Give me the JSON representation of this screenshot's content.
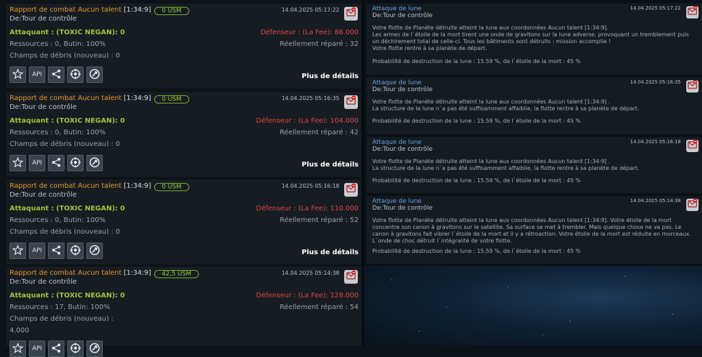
{
  "combat_reports": [
    {
      "title": "Rapport de combat Aucun talent",
      "coords": "[1:34:9]",
      "usm": "0 USM",
      "from": "De:Tour de contrôle",
      "date": "14.04.2025 05:17:22",
      "attacker": "Attaquant : (TOXIC NEGAN): 0",
      "defender": "Défenseur : (La Fee): 86.000",
      "resources": "Ressources : 0, Butin: 100%",
      "repaired": "Réellement réparé : 32",
      "debris": "Champs de débris (nouveau) : 0",
      "debris_value": "",
      "more": "Plus de détails"
    },
    {
      "title": "Rapport de combat Aucun talent",
      "coords": "[1:34:9]",
      "usm": "0 USM",
      "from": "De:Tour de contrôle",
      "date": "14.04.2025 05:16:35",
      "attacker": "Attaquant : (TOXIC NEGAN): 0",
      "defender": "Défenseur : (La Fee): 104.000",
      "resources": "Ressources : 0, Butin: 100%",
      "repaired": "Réellement réparé : 42",
      "debris": "Champs de débris (nouveau) : 0",
      "debris_value": "",
      "more": "Plus de détails"
    },
    {
      "title": "Rapport de combat Aucun talent",
      "coords": "[1:34:9]",
      "usm": "0 USM",
      "from": "De:Tour de contrôle",
      "date": "14.04.2025 05:16:18",
      "attacker": "Attaquant : (TOXIC NEGAN): 0",
      "defender": "Défenseur : (La Fee): 110.000",
      "resources": "Ressources : 0, Butin: 100%",
      "repaired": "Réellement réparé : 52",
      "debris": "Champs de débris (nouveau) : 0",
      "debris_value": "",
      "more": "Plus de détails"
    },
    {
      "title": "Rapport de combat Aucun talent",
      "coords": "[1:34:9]",
      "usm": "42,5 USM",
      "from": "De:Tour de contrôle",
      "date": "14.04.2025 05:14:38",
      "attacker": "Attaquant : (TOXIC NEGAN): 0",
      "defender": "Défenseur : (La Fee): 128.000",
      "resources": "Ressources : 17, Butin: 100%",
      "repaired": "Réellement réparé : 54",
      "debris": "Champs de débris (nouveau) :",
      "debris_value": "4.000",
      "more": ""
    }
  ],
  "action_buttons": [
    {
      "icon": "star-icon",
      "label": ""
    },
    {
      "icon": "api-icon",
      "label": "API"
    },
    {
      "icon": "share-icon",
      "label": ""
    },
    {
      "icon": "target-icon",
      "label": ""
    },
    {
      "icon": "attack-icon",
      "label": ""
    }
  ],
  "moon_reports": [
    {
      "title": "Attaque de lune",
      "from": "De:Tour de contrôle",
      "date": "14.04.2025 05:17:22",
      "body": "Votre flotte de Planète détruite atteint la lune aux coordonnées Aucun talent [1:34:9].\nLes armes de l`étoile de la mort tirent une onde de gravitons sur la lune adverse, provoquant un tremblement puis un déchirement total de celle-ci. Tous les bâtiments sont détruits : mission accomplie !\nVotre flotte rentre à sa planète de départ.",
      "probability": "Probabilité de destruction de la lune : 15.59 %, de l`étoile de la mort : 45 %"
    },
    {
      "title": "Attaque de lune",
      "from": "De:Tour de contrôle",
      "date": "14.04.2025 05:16:35",
      "body": "Votre flotte de Planète détruite atteint la lune aux coordonnées Aucun talent [1:34:9] .\nLa structure de la lune n`a pas été suffisamment affaiblie, la flotte rentre à sa planète de départ.",
      "probability": "Probabilité de destruction de la lune : 15.59 %, de l`étoile de la mort : 45 %"
    },
    {
      "title": "Attaque de lune",
      "from": "De:Tour de contrôle",
      "date": "14.04.2025 05:16:18",
      "body": "Votre flotte de Planète détruite atteint la lune aux coordonnées Aucun talent [1:34:9] .\nLa structure de la lune n`a pas été suffisamment affaiblie, la flotte rentre à sa planète de départ.",
      "probability": "Probabilité de destruction de la lune : 15.59 %, de l`étoile de la mort : 45 %"
    },
    {
      "title": "Attaque de lune",
      "from": "De:Tour de contrôle",
      "date": "14.04.2025 05:14:38",
      "body": "Votre flotte de Planète détruite atteint la lune aux coordonnées Aucun talent [1:34:9]. Votre étoile de la mort concentre son canon à gravitons sur le satellite. Sa surface se met à trembler. Mais quelque chose ne va pas. Le canon à gravitons fait vibrer l`étoile de la mort et il y a rétroaction. Votre étoile de la mort est réduite en morceaux. L`onde de choc détruit l`intégralité de votre flotte.",
      "probability": "Probabilité de destruction de la lune : 15.59 %, de l`étoile de la mort : 45 %"
    }
  ],
  "colors": {
    "title_orange": "#e89a2a",
    "attacker_green": "#a2c43a",
    "defender_red": "#e04848",
    "moon_title_blue": "#6aa3e0",
    "usm_green": "#9bd13a"
  }
}
